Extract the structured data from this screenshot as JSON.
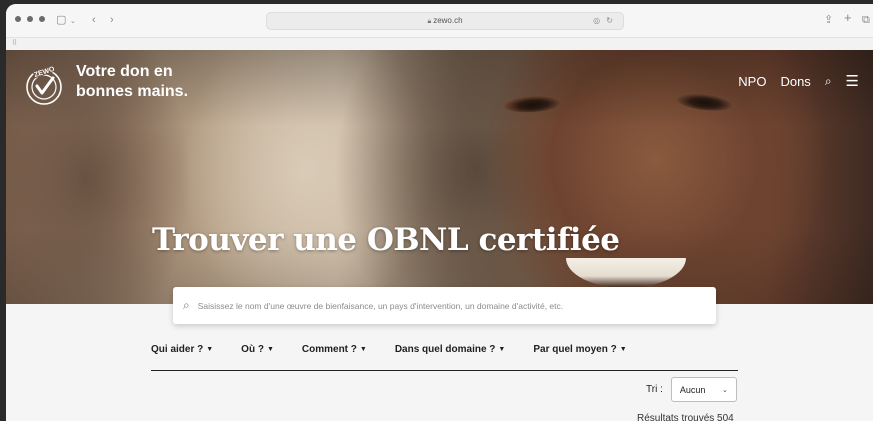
{
  "browser": {
    "url": "zewo.ch",
    "bookmarks_icon": "grid-icon"
  },
  "header": {
    "logo_text": "ZEWO",
    "tagline_line1": "Votre don en",
    "tagline_line2": "bonnes mains.",
    "nav": [
      {
        "label": "NPO"
      },
      {
        "label": "Dons"
      }
    ]
  },
  "hero": {
    "title": "Trouver une OBNL certifiée"
  },
  "search": {
    "placeholder": "Saisissez le nom d'une œuvre de bienfaisance, un pays d'intervention, un domaine d'activité, etc."
  },
  "filters": [
    {
      "label": "Qui aider ?"
    },
    {
      "label": "Où ?"
    },
    {
      "label": "Comment ?"
    },
    {
      "label": "Dans quel domaine ?"
    },
    {
      "label": "Par quel moyen ?"
    }
  ],
  "sort": {
    "label": "Tri :",
    "value": "Aucun"
  },
  "results": {
    "text": "Résultats trouvés 504"
  },
  "colors": {
    "page_bg": "#f5f5f5",
    "hero_text": "#ffffff",
    "filter_text": "#1f1f1f"
  }
}
